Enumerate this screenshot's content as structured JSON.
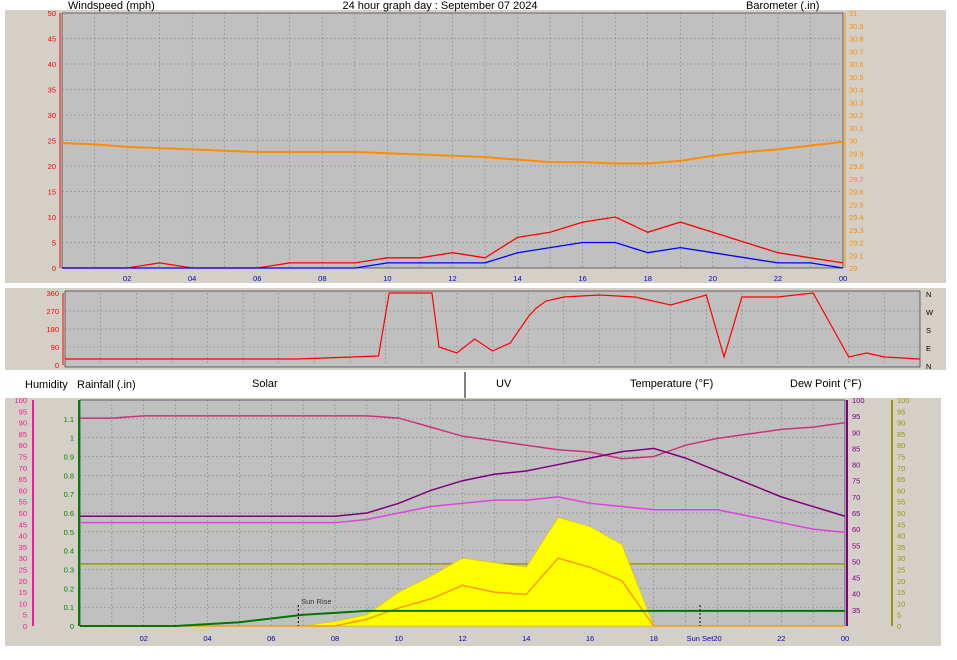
{
  "panel1": {
    "left_label": "Windspeed (mph)",
    "title": "24 hour graph day : September 07 2024",
    "right_label": "Barometer (.in)"
  },
  "panel3": {
    "humidity_label": "Humidity",
    "rainfall_label": "Rainfall (.in)",
    "solar_label": "Solar",
    "uv_label": "UV",
    "temperature_label": "Temperature (°F)",
    "dewpoint_label": "Dew Point (°F)",
    "sunrise_label": "Sun Rise",
    "sunset_label": "Sun Set"
  },
  "colors": {
    "wind_gust": "#ff0000",
    "wind_avg": "#0000ff",
    "barometer": "#ff8c00",
    "wind_dir": "#ff0000",
    "humidity": "#cc3377",
    "temperature": "#800080",
    "dew_point": "#e040e0",
    "solar": "#ffff00",
    "uv": "#ff9900",
    "rainfall": "#007700",
    "uv_ref": "#999900",
    "plot_bg": "#c0c0c0",
    "axis_humidity": "#ff1493",
    "axis_uv": "#ff8c00",
    "axis_dew": "#999900"
  },
  "chart_data": [
    {
      "type": "line",
      "name": "wind-barometer",
      "title": "24 hour graph day : September 07 2024",
      "x_ticks": [
        "02",
        "04",
        "06",
        "08",
        "10",
        "12",
        "14",
        "16",
        "18",
        "20",
        "22",
        "00"
      ],
      "left_axis": {
        "label": "Windspeed (mph)",
        "range": [
          0,
          50
        ],
        "ticks": [
          "0",
          "5",
          "10",
          "15",
          "20",
          "25",
          "30",
          "35",
          "40",
          "45",
          "50"
        ]
      },
      "right_axis": {
        "label": "Barometer (.in)",
        "range": [
          29.0,
          31.0
        ],
        "ticks": [
          "29",
          "29.1",
          "29.2",
          "29.3",
          "29.4",
          "29.5",
          "29.6",
          "29.7",
          "29.8",
          "29.9",
          "30",
          "30.1",
          "30.2",
          "30.3",
          "30.4",
          "30.5",
          "30.6",
          "30.7",
          "30.8",
          "30.9",
          "31"
        ]
      },
      "x_hours": [
        0,
        1,
        2,
        3,
        4,
        5,
        6,
        7,
        8,
        9,
        10,
        11,
        12,
        13,
        14,
        15,
        16,
        17,
        18,
        19,
        20,
        21,
        22,
        23,
        24
      ],
      "series": [
        {
          "name": "barometer",
          "axis": "right",
          "values": [
            29.98,
            29.97,
            29.95,
            29.94,
            29.93,
            29.92,
            29.91,
            29.91,
            29.91,
            29.91,
            29.9,
            29.89,
            29.88,
            29.87,
            29.85,
            29.83,
            29.83,
            29.82,
            29.82,
            29.84,
            29.88,
            29.91,
            29.93,
            29.96,
            29.99
          ]
        },
        {
          "name": "wind gust",
          "axis": "left",
          "values": [
            0,
            0,
            0,
            1,
            0,
            0,
            0,
            1,
            1,
            1,
            2,
            2,
            3,
            2,
            6,
            7,
            9,
            10,
            7,
            9,
            7,
            5,
            3,
            2,
            1
          ]
        },
        {
          "name": "wind average",
          "axis": "left",
          "values": [
            0,
            0,
            0,
            0,
            0,
            0,
            0,
            0,
            0,
            0,
            1,
            1,
            1,
            1,
            3,
            4,
            5,
            5,
            3,
            4,
            3,
            2,
            1,
            1,
            0
          ]
        }
      ]
    },
    {
      "type": "line",
      "name": "wind-direction",
      "left_ticks": [
        "0",
        "90",
        "180",
        "270",
        "360"
      ],
      "right_ticks": [
        "N",
        "E",
        "S",
        "W",
        "N"
      ],
      "range": [
        0,
        360
      ],
      "x_hours": [
        0,
        3,
        6.5,
        8.8,
        9.1,
        10.3,
        10.5,
        11,
        11.5,
        12,
        12.5,
        13,
        13.2,
        13.5,
        14,
        15,
        16,
        17,
        18,
        18.5,
        19,
        20,
        21,
        22,
        22.5,
        23,
        24
      ],
      "series": [
        {
          "name": "wind direction",
          "values": [
            30,
            30,
            30,
            45,
            360,
            360,
            90,
            60,
            130,
            70,
            110,
            240,
            280,
            320,
            340,
            350,
            340,
            300,
            350,
            40,
            340,
            340,
            360,
            40,
            60,
            40,
            30
          ]
        }
      ]
    },
    {
      "type": "area",
      "name": "solar-temperature",
      "x_ticks": [
        "02",
        "04",
        "06",
        "08",
        "10",
        "12",
        "14",
        "16",
        "18",
        "20",
        "22",
        "00"
      ],
      "humidity_axis": {
        "label": "Humidity",
        "range": [
          0,
          100
        ],
        "ticks": [
          "0",
          "5",
          "10",
          "15",
          "20",
          "25",
          "30",
          "35",
          "40",
          "45",
          "50",
          "55",
          "60",
          "65",
          "70",
          "75",
          "80",
          "85",
          "90",
          "95",
          "100"
        ]
      },
      "rainfall_axis": {
        "label": "Rainfall (.in)",
        "range": [
          0,
          1.2
        ],
        "ticks": [
          "0",
          "0.1",
          "0.2",
          "0.3",
          "0.4",
          "0.5",
          "0.6",
          "0.7",
          "0.8",
          "0.9",
          "1",
          "1.1"
        ]
      },
      "temperature_axis": {
        "label": "Temperature (°F)",
        "range": [
          30,
          100
        ],
        "ticks": [
          "35",
          "40",
          "45",
          "50",
          "55",
          "60",
          "65",
          "70",
          "75",
          "80",
          "85",
          "90",
          "95",
          "100"
        ]
      },
      "dewpoint_axis": {
        "label": "Dew Point (°F)",
        "range": [
          0,
          100
        ],
        "ticks": [
          "0",
          "5",
          "10",
          "15",
          "20",
          "25",
          "30",
          "35",
          "40",
          "45",
          "50",
          "55",
          "60",
          "65",
          "70",
          "75",
          "80",
          "85",
          "90",
          "95",
          "100"
        ]
      },
      "x_hours": [
        0,
        1,
        2,
        3,
        4,
        5,
        6,
        7,
        8,
        9,
        10,
        11,
        12,
        13,
        14,
        15,
        16,
        17,
        18,
        19,
        20,
        21,
        22,
        23,
        24
      ],
      "series": [
        {
          "name": "humidity",
          "axis": "humidity",
          "values": [
            92,
            92,
            93,
            93,
            93,
            93,
            93,
            93,
            93,
            93,
            92,
            88,
            84,
            82,
            80,
            78,
            77,
            74,
            75,
            80,
            83,
            85,
            87,
            88,
            90
          ]
        },
        {
          "name": "temperature",
          "axis": "temperature",
          "values": [
            64,
            64,
            64,
            64,
            64,
            64,
            64,
            64,
            64,
            65,
            68,
            72,
            75,
            77,
            78,
            80,
            82,
            84,
            85,
            82,
            78,
            74,
            70,
            67,
            64
          ]
        },
        {
          "name": "dew point",
          "axis": "temperature",
          "values": [
            62,
            62,
            62,
            62,
            62,
            62,
            62,
            62,
            62,
            63,
            65,
            67,
            68,
            69,
            69,
            70,
            68,
            67,
            66,
            66,
            66,
            64,
            62,
            60,
            59
          ]
        },
        {
          "name": "solar",
          "axis": "humidity",
          "values": [
            0,
            0,
            0,
            0,
            0,
            0,
            0,
            0,
            2,
            5,
            15,
            22,
            30,
            28,
            26,
            48,
            44,
            36,
            0,
            0,
            0,
            0,
            0,
            0,
            0
          ]
        },
        {
          "name": "uv",
          "axis": "humidity",
          "values": [
            0,
            0,
            0,
            0,
            0,
            0,
            0,
            0,
            0,
            3,
            8,
            12,
            18,
            15,
            14,
            30,
            26,
            20,
            0,
            0,
            0,
            0,
            0,
            0,
            0
          ]
        },
        {
          "name": "rainfall",
          "axis": "rainfall",
          "values": [
            0,
            0,
            0,
            0,
            0.01,
            0.02,
            0.04,
            0.06,
            0.07,
            0.08,
            0.08,
            0.08,
            0.08,
            0.08,
            0.08,
            0.08,
            0.08,
            0.08,
            0.08,
            0.08,
            0.08,
            0.08,
            0.08,
            0.08,
            0.08
          ]
        }
      ],
      "sunrise_hour": 6.85,
      "sunset_hour": 19.45
    }
  ]
}
